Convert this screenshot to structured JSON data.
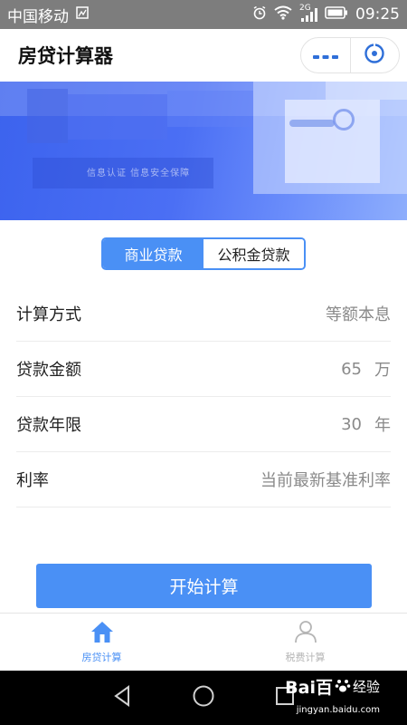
{
  "status_bar": {
    "carrier": "中国移动",
    "network": "2G",
    "time": "09:25"
  },
  "app": {
    "title": "房贷计算器"
  },
  "capsule": {
    "more_icon": "dots-icon",
    "close_icon": "target-close-icon"
  },
  "banner": {
    "caption": "信息认证  信息安全保障"
  },
  "loan_tabs": [
    {
      "label": "商业贷款",
      "active": true
    },
    {
      "label": "公积金贷款",
      "active": false
    }
  ],
  "form": {
    "method": {
      "label": "计算方式",
      "value": "等额本息"
    },
    "amount": {
      "label": "贷款金额",
      "value": "65",
      "unit": "万"
    },
    "term": {
      "label": "贷款年限",
      "value": "30",
      "unit": "年"
    },
    "rate": {
      "label": "利率",
      "value": "当前最新基准利率"
    }
  },
  "start_button": {
    "label": "开始计算"
  },
  "bottom_tabs": [
    {
      "label": "房贷计算",
      "icon": "home-icon",
      "active": true
    },
    {
      "label": "税费计算",
      "icon": "person-icon",
      "active": false
    }
  ],
  "watermark": {
    "brand": "Bai百",
    "jingyan": "经验",
    "url": "jingyan.baidu.com"
  },
  "colors": {
    "accent": "#4a90f5",
    "status_bar": "#7d7d7d",
    "banner": "#4b6ff4"
  }
}
